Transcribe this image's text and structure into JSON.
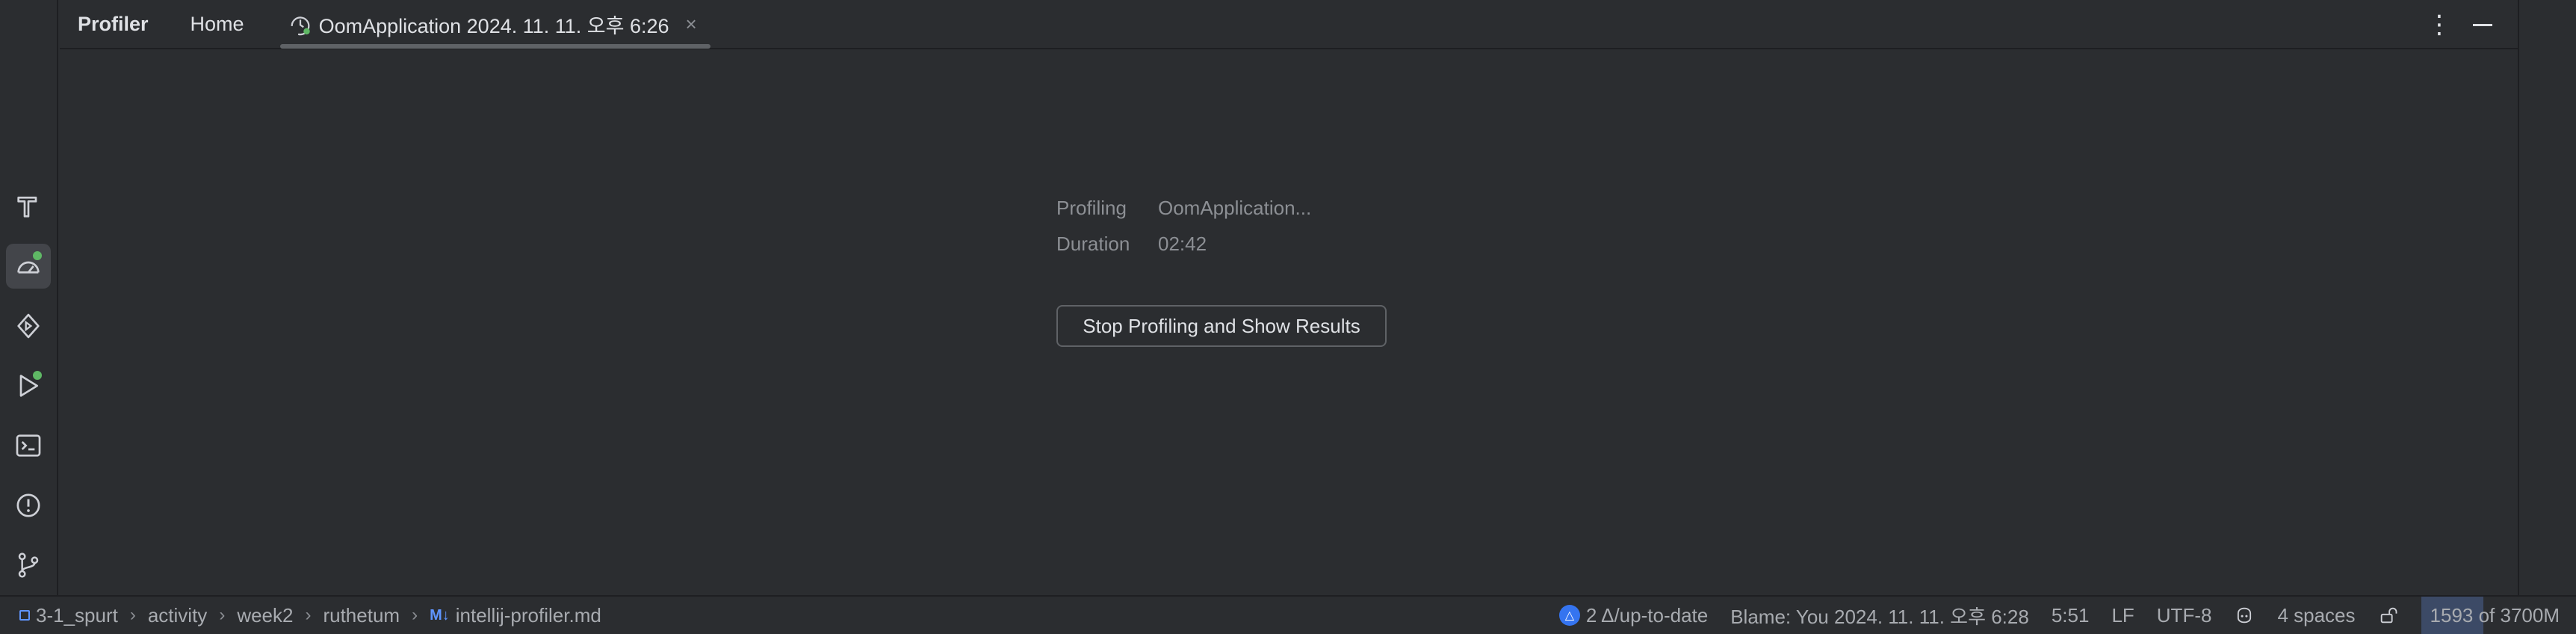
{
  "tool_window": {
    "title": "Profiler",
    "tabs": [
      {
        "label": "Home"
      },
      {
        "label": "OomApplication 2024. 11. 11. 오후 6:26",
        "close": "×"
      }
    ],
    "more_icon": "⋮"
  },
  "left_toolbar": {
    "items": [
      {
        "icon": "build-hammer-icon"
      },
      {
        "icon": "profiler-icon",
        "active": true,
        "badge": true
      },
      {
        "icon": "services-icon"
      },
      {
        "icon": "run-icon",
        "badge": true
      },
      {
        "icon": "terminal-icon"
      },
      {
        "icon": "problems-icon"
      },
      {
        "icon": "git-branch-icon"
      }
    ]
  },
  "session": {
    "profiling_label": "Profiling",
    "profiling_value": "OomApplication...",
    "duration_label": "Duration",
    "duration_value": "02:42",
    "stop_button": "Stop Profiling and Show Results"
  },
  "status_bar": {
    "breadcrumbs": [
      "3-1_spurt",
      "activity",
      "week2",
      "ruthetum",
      "intellij-profiler.md"
    ],
    "md_badge": "M↓",
    "vcs_status": "2 Δ/up-to-date",
    "vcs_badge": "△",
    "blame": "Blame: You 2024. 11. 11. 오후 6:28",
    "position": "5:51",
    "line_separator": "LF",
    "encoding": "UTF-8",
    "indent": "4 spaces",
    "memory": "1593 of 3700M"
  },
  "colors": {
    "background": "#2b2d30",
    "border": "#1e1f22",
    "text": "#dfe1e5",
    "muted_text": "#8c8f94",
    "accent_green": "#5fb865",
    "accent_blue": "#3574f0"
  }
}
